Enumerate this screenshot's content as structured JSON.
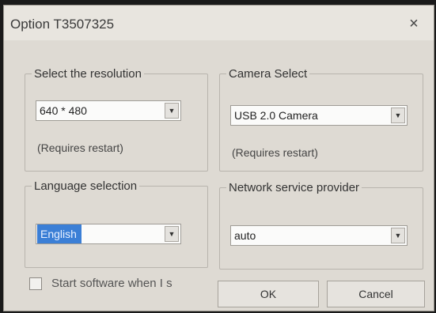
{
  "window": {
    "title": "Option T3507325",
    "close_glyph": "×"
  },
  "resolution": {
    "legend": "Select the resolution",
    "value": "640 * 480",
    "note": "(Requires restart)"
  },
  "camera": {
    "legend": "Camera Select",
    "value": "USB 2.0 Camera",
    "note": "(Requires restart)"
  },
  "language": {
    "legend": "Language selection",
    "value": "English"
  },
  "network": {
    "legend": "Network service provider",
    "value": "auto"
  },
  "startup": {
    "label": "Start software when I s",
    "checked": false
  },
  "buttons": {
    "ok": "OK",
    "cancel": "Cancel"
  },
  "icons": {
    "dropdown": "chevron-down-icon",
    "close": "close-icon"
  },
  "colors": {
    "selection": "#3b7fd6",
    "dialog_bg": "#dedad3"
  }
}
